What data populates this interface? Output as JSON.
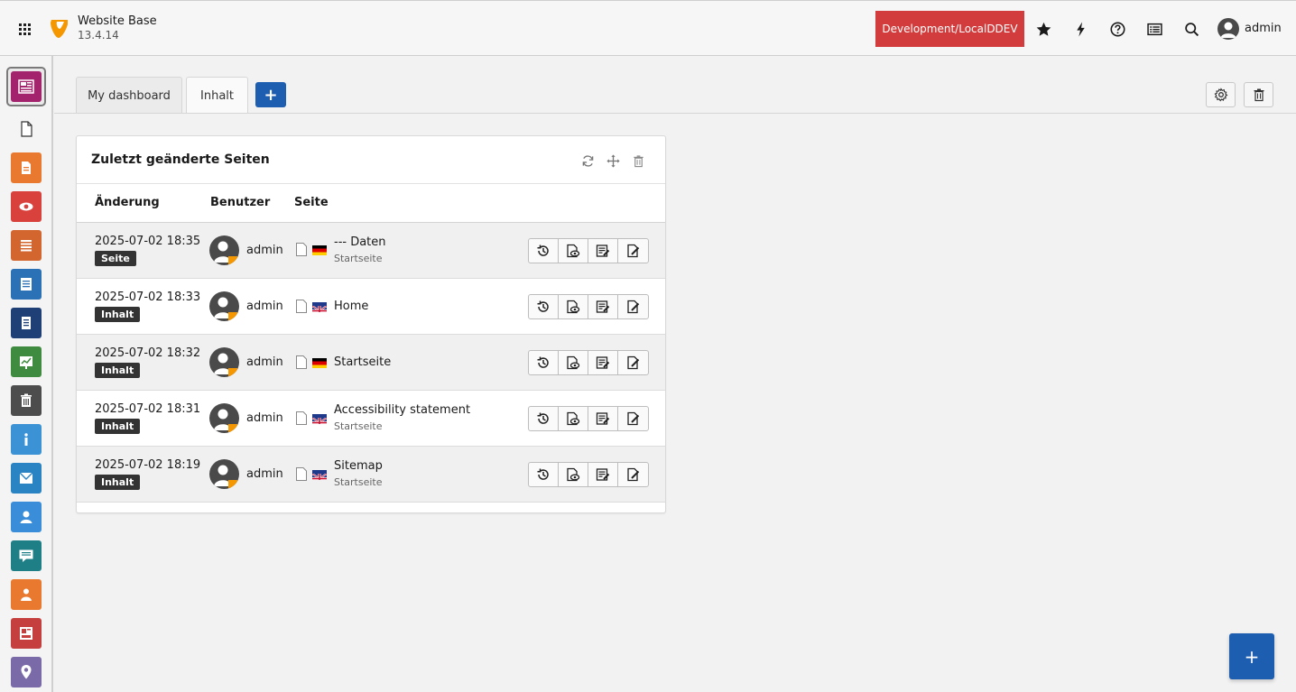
{
  "header": {
    "site_title": "Website Base",
    "site_version": "13.4.14",
    "environment": "Development/LocalDDEV",
    "user_name": "admin",
    "icons": [
      "apps-grid-icon",
      "typo3-logo",
      "star-icon",
      "flash-icon",
      "help-icon",
      "list-icon",
      "search-icon",
      "user-avatar-icon"
    ]
  },
  "sidebar": {
    "items": [
      {
        "name": "dashboard",
        "color": "#a3236d"
      },
      {
        "name": "page",
        "color": ""
      },
      {
        "name": "page-orange",
        "color": "#e8792f"
      },
      {
        "name": "view",
        "color": "#d8413c"
      },
      {
        "name": "list",
        "color": "#d3662f"
      },
      {
        "name": "forms",
        "color": "#2b71b5"
      },
      {
        "name": "news",
        "color": "#1f3f77"
      },
      {
        "name": "reports",
        "color": "#3f8b3f"
      },
      {
        "name": "recycler",
        "color": "#4d4d4d"
      },
      {
        "name": "info",
        "color": "#3b93d6"
      },
      {
        "name": "mail",
        "color": "#2a83c2"
      },
      {
        "name": "user",
        "color": "#3a8dd8"
      },
      {
        "name": "comments",
        "color": "#1f7f87"
      },
      {
        "name": "users-orange",
        "color": "#e8792f"
      },
      {
        "name": "templates",
        "color": "#c53f3f"
      },
      {
        "name": "location",
        "color": "#7a6aa8"
      }
    ]
  },
  "tabs": {
    "items": [
      {
        "label": "My dashboard"
      },
      {
        "label": "Inhalt"
      }
    ],
    "add_label": "+"
  },
  "widget": {
    "title": "Zuletzt geänderte Seiten",
    "columns": [
      "Änderung",
      "Benutzer",
      "Seite"
    ],
    "rows": [
      {
        "date": "2025-07-02 18:35",
        "type": "Seite",
        "user": "admin",
        "flag": "de",
        "title": "--- Daten",
        "subtitle": "Startseite"
      },
      {
        "date": "2025-07-02 18:33",
        "type": "Inhalt",
        "user": "admin",
        "flag": "uk",
        "title": "Home",
        "subtitle": ""
      },
      {
        "date": "2025-07-02 18:32",
        "type": "Inhalt",
        "user": "admin",
        "flag": "de",
        "title": "Startseite",
        "subtitle": ""
      },
      {
        "date": "2025-07-02 18:31",
        "type": "Inhalt",
        "user": "admin",
        "flag": "uk",
        "title": "Accessibility statement",
        "subtitle": "Startseite"
      },
      {
        "date": "2025-07-02 18:19",
        "type": "Inhalt",
        "user": "admin",
        "flag": "uk",
        "title": "Sitemap",
        "subtitle": "Startseite"
      }
    ]
  },
  "fab_label": "+"
}
